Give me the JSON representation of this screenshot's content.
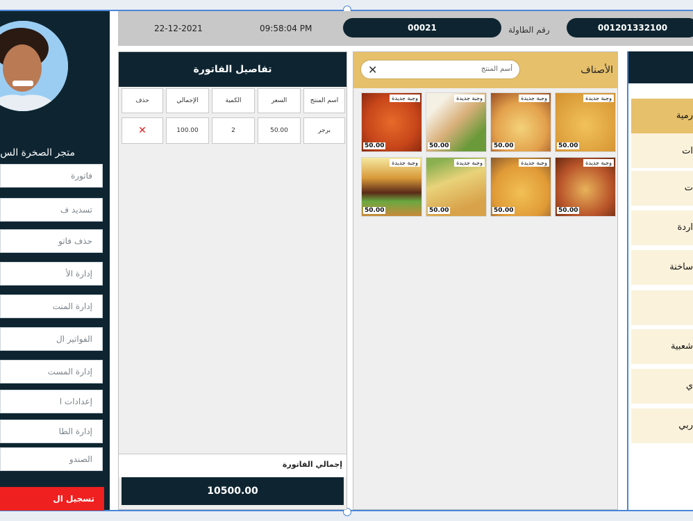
{
  "header": {
    "date": "22-12-2021",
    "time": "09:58:04 PM",
    "table_number_label": "رقم الطاولة",
    "table_number": "00021",
    "invoice_code": "001201332100"
  },
  "sidebar": {
    "store_name": "متجر الصخرة الس",
    "menu": [
      "فاتورة",
      "تسديد ف",
      "حذف فاتو",
      "إدارة الأ",
      "إدارة المنت",
      "الفواتير ال",
      "إدارة المست",
      "إعدادات ا",
      "إدارة الطا",
      "الصندو"
    ],
    "logout_label": "تسجيل ال"
  },
  "invoice": {
    "title": "تفاصيل الفاتورة",
    "columns": [
      "اسم المنتج",
      "السعر",
      "الكمية",
      "الإجمالي",
      "حذف"
    ],
    "rows": [
      {
        "product": "برجر",
        "price": "50.00",
        "qty": "2",
        "total": "100.00",
        "delete": "✕"
      }
    ],
    "total_label": "إجمالي الفاتورة",
    "total_value": "10500.00"
  },
  "products": {
    "title": "الأصناف",
    "search_placeholder": "أسم المنتج",
    "search_clear": "✕",
    "items": [
      {
        "tag": "وجبة جديدة",
        "price": "50.00"
      },
      {
        "tag": "وجبة جديدة",
        "price": "50.00"
      },
      {
        "tag": "وجبة جديدة",
        "price": "50.00"
      },
      {
        "tag": "وجبة جديدة",
        "price": "50.00"
      },
      {
        "tag": "وجبة جديدة",
        "price": "50.00"
      },
      {
        "tag": "وجبة جديدة",
        "price": "50.00"
      },
      {
        "tag": "وجبة جديدة",
        "price": "50.00"
      },
      {
        "tag": "وجبة جديدة",
        "price": "50.00"
      }
    ]
  },
  "categories": [
    "رمية",
    "ات",
    "ت",
    "اردة",
    "ساخنة",
    "",
    "شعبية",
    "ي",
    "ربي"
  ],
  "colors": {
    "navy": "#0e2531",
    "gold": "#e6c06b",
    "cream": "#fbf2db",
    "danger": "#ef2020"
  }
}
